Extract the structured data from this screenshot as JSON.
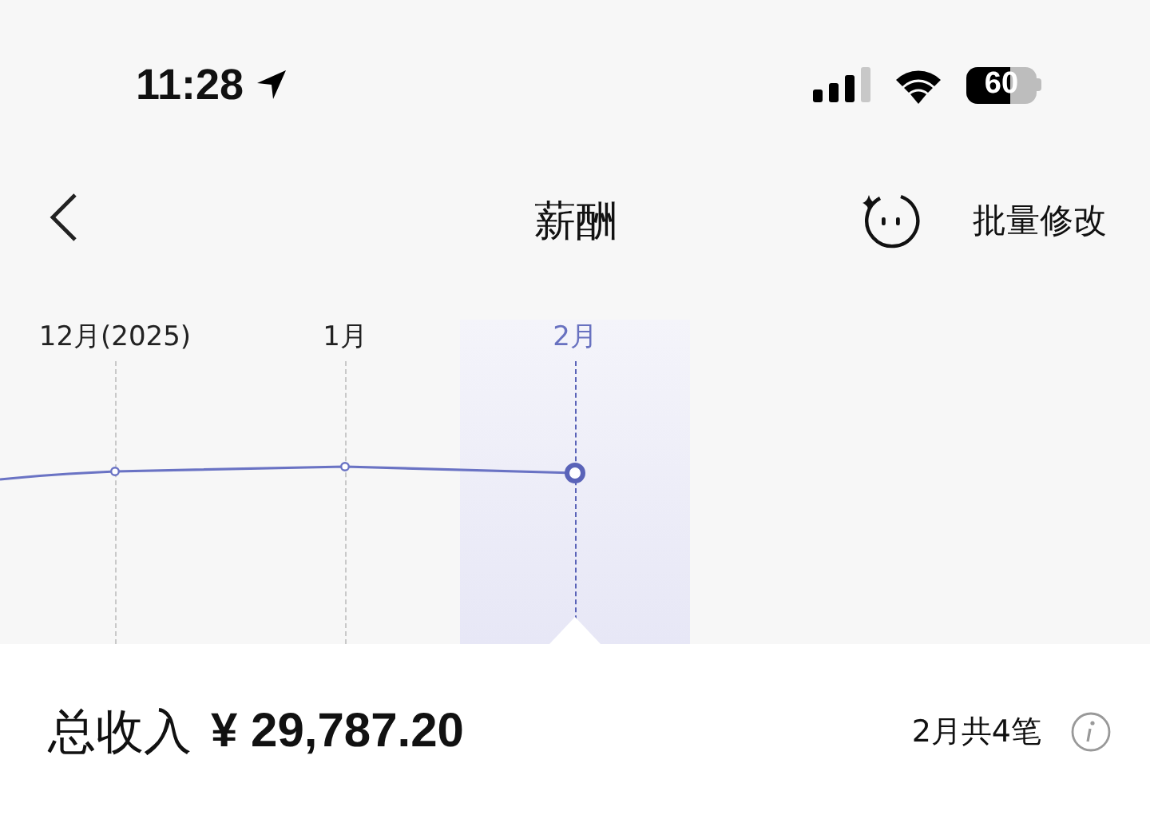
{
  "status_bar": {
    "time": "11:28",
    "battery": "60"
  },
  "nav": {
    "title": "薪酬",
    "action": "批量修改"
  },
  "months": [
    {
      "label": "12月(2025)",
      "selected": false
    },
    {
      "label": "1月",
      "selected": false
    },
    {
      "label": "2月",
      "selected": true
    }
  ],
  "summary": {
    "label": "总收入",
    "amount": "¥ 29,787.20",
    "count": "2月共4笔"
  }
}
